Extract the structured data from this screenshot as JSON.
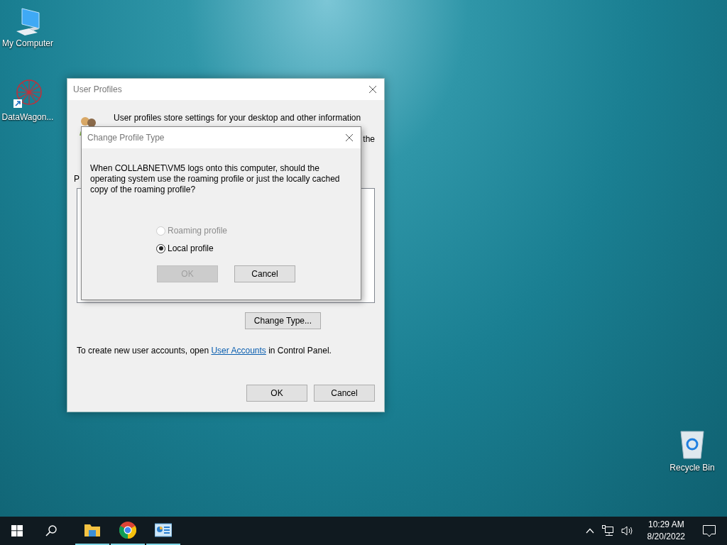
{
  "desktop": {
    "icons": [
      {
        "label": "My Computer",
        "kind": "computer"
      },
      {
        "label": "DataWagon...",
        "kind": "app"
      },
      {
        "label": "Recycle Bin",
        "kind": "recycle"
      }
    ]
  },
  "user_profiles": {
    "title": "User Profiles",
    "intro": "User profiles store settings for your desktop and other information",
    "intro_tail": "the",
    "list_label": "P",
    "change_type_button": "Change Type...",
    "footer": {
      "before": "To create new user accounts, open",
      "link": "User Accounts",
      "after": "in Control Panel."
    },
    "buttons": [
      "OK",
      "Cancel"
    ]
  },
  "change_profile_type": {
    "title": "Change Profile Type",
    "question": "When COLLABNET\\VM5 logs onto this computer, should the operating system use the roaming profile or just the locally cached copy of the roaming profile?",
    "options": [
      {
        "label": "Roaming profile",
        "selected": false,
        "disabled": true
      },
      {
        "label": "Local profile",
        "selected": true,
        "disabled": false
      }
    ],
    "buttons": [
      {
        "label": "OK",
        "disabled": true
      },
      {
        "label": "Cancel",
        "disabled": false
      }
    ]
  },
  "taskbar": {
    "apps": [
      {
        "kind": "folder",
        "running": true
      },
      {
        "kind": "browser",
        "running": true
      },
      {
        "kind": "control-panel",
        "running": true
      }
    ],
    "time": "10:29 AM",
    "date": "8/20/2022"
  }
}
